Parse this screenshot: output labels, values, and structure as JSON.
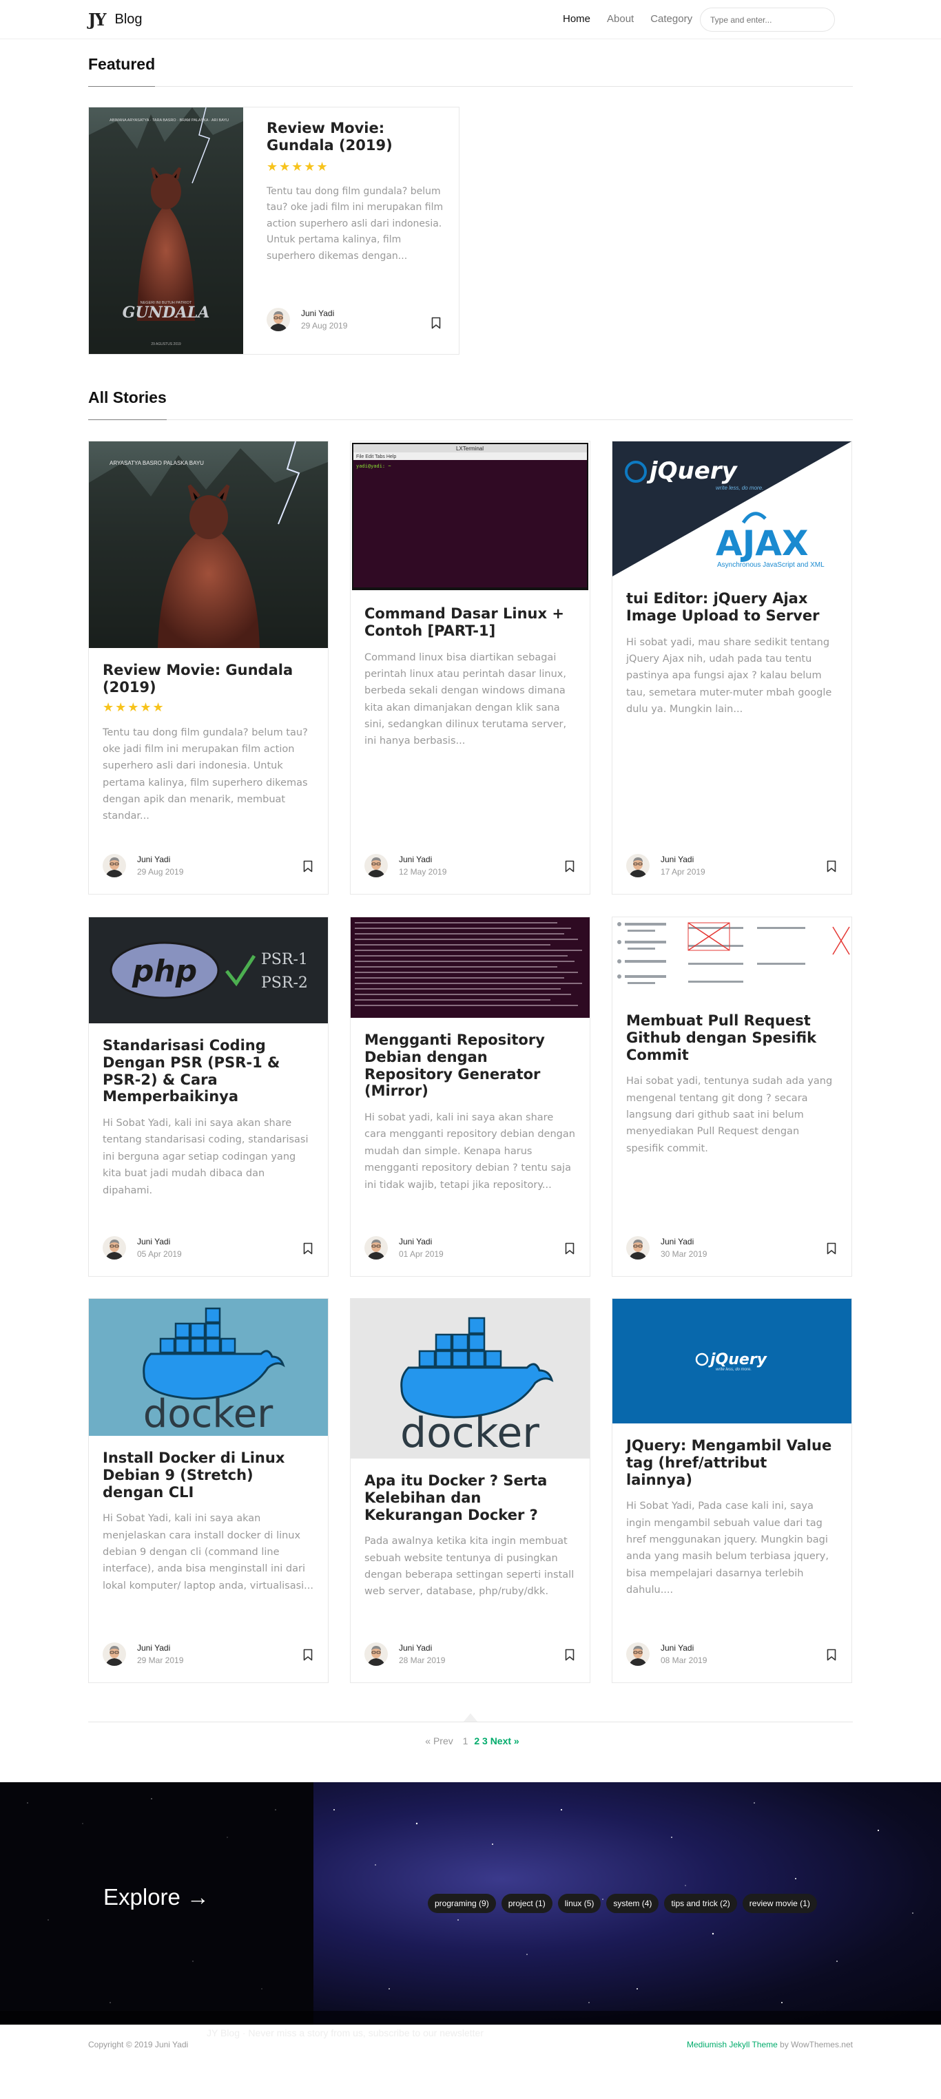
{
  "nav": {
    "logo": "JY",
    "brand": "Blog",
    "links": [
      "Home",
      "About",
      "Category"
    ],
    "search_placeholder": "Type and enter..."
  },
  "featured_section": {
    "title": "Featured",
    "post": {
      "title": "Review Movie: Gundala (2019)",
      "stars": "★★★★★",
      "excerpt": "Tentu tau dong film gundala? belum tau? oke jadi film ini merupakan film action superhero asli dari indonesia. Untuk pertama kalinya, film superhero dikemas dengan...",
      "author": "Juni Yadi",
      "date": "29 Aug 2019"
    }
  },
  "stories_section": {
    "title": "All Stories",
    "posts": [
      {
        "title": "Review Movie: Gundala (2019)",
        "stars": "★★★★★",
        "excerpt": "Tentu tau dong film gundala? belum tau? oke jadi film ini merupakan film action superhero asli dari indonesia. Untuk pertama kalinya, film superhero dikemas dengan apik dan menarik, membuat standar...",
        "author": "Juni Yadi",
        "date": "29 Aug 2019"
      },
      {
        "title": "Command Dasar Linux + Contoh [PART-1]",
        "stars": "",
        "excerpt": "Command linux bisa diartikan sebagai perintah linux atau perintah dasar linux, berbeda sekali dengan windows dimana kita akan dimanjakan dengan klik sana sini, sedangkan dilinux terutama server, ini hanya berbasis...",
        "author": "Juni Yadi",
        "date": "12 May 2019"
      },
      {
        "title": "tui Editor: jQuery Ajax Image Upload to Server",
        "stars": "",
        "excerpt": "Hi sobat yadi, mau share sedikit tentang jQuery Ajax nih, udah pada tau tentu pastinya apa fungsi ajax ? kalau belum tau, semetara muter-muter mbah google dulu ya. Mungkin lain...",
        "author": "Juni Yadi",
        "date": "17 Apr 2019"
      },
      {
        "title": "Standarisasi Coding Dengan PSR (PSR-1 & PSR-2) & Cara Memperbaikinya",
        "stars": "",
        "excerpt": "Hi Sobat Yadi, kali ini saya akan share tentang standarisasi coding, standarisasi ini berguna agar setiap codingan yang kita buat jadi mudah dibaca dan dipahami.",
        "author": "Juni Yadi",
        "date": "05 Apr 2019"
      },
      {
        "title": "Mengganti Repository Debian dengan Repository Generator (Mirror)",
        "stars": "",
        "excerpt": "Hi sobat yadi, kali ini saya akan share cara mengganti repository debian dengan mudah dan simple. Kenapa harus mengganti repository debian ? tentu saja ini tidak wajib, tetapi jika repository...",
        "author": "Juni Yadi",
        "date": "01 Apr 2019"
      },
      {
        "title": "Membuat Pull Request Github dengan Spesifik Commit",
        "stars": "",
        "excerpt": "Hai sobat yadi, tentunya sudah ada yang mengenal tentang git dong ? secara langsung dari github saat ini belum menyediakan Pull Request dengan spesifik commit.",
        "author": "Juni Yadi",
        "date": "30 Mar 2019"
      },
      {
        "title": "Install Docker di Linux Debian 9 (Stretch) dengan CLI",
        "stars": "",
        "excerpt": "Hi Sobat Yadi, kali ini saya akan menjelaskan cara install docker di linux debian 9 dengan cli (command line interface), anda bisa menginstall ini dari lokal komputer/ laptop anda, virtualisasi...",
        "author": "Juni Yadi",
        "date": "29 Mar 2019"
      },
      {
        "title": "Apa itu Docker ? Serta Kelebihan dan Kekurangan Docker ?",
        "stars": "",
        "excerpt": "Pada awalnya ketika kita ingin membuat sebuah website tentunya di pusingkan dengan beberapa settingan seperti install web server, database, php/ruby/dkk.",
        "author": "Juni Yadi",
        "date": "28 Mar 2019"
      },
      {
        "title": "JQuery: Mengambil Value tag (href/attribut lainnya)",
        "stars": "",
        "excerpt": "Hi Sobat Yadi, Pada case kali ini, saya ingin mengambil sebuah value dari tag href menggunakan jquery. Mungkin bagi anda yang masih belum terbiasa jquery, bisa mempelajari dasarnya terlebih dahulu....",
        "author": "Juni Yadi",
        "date": "08 Mar 2019"
      }
    ]
  },
  "images": {
    "gundala_caption": "GUNDALA",
    "gundala_tagline": "NEGERI INI BUTUH PATRIOT",
    "gundala_names": [
      "ABIMANA ARYASATYA",
      "TARA BASRO",
      "BRAM PALASKA",
      "RIO DEWANTO",
      "ARI BAYU"
    ],
    "gundala_release": "29 AGUSTUS 2019",
    "terminal_title": "LXTerminal",
    "terminal_menu": [
      "File",
      "Edit",
      "Tabs",
      "Help"
    ],
    "terminal_prompt": "yadi@yadi: ~",
    "jquery_logo": "jQuery",
    "jquery_tagline": "write less, do more.",
    "ajax_logo": "AJAX",
    "ajax_tagline": "Asynchronous JavaScript and XML",
    "php_logo": "php",
    "psr1": "PSR-1",
    "psr2": "PSR-2",
    "docker_logo": "docker"
  },
  "pagination": {
    "prev": "« Prev",
    "pages": [
      "1",
      "2",
      "3"
    ],
    "next": "Next »"
  },
  "explore": {
    "title": "Explore →",
    "tags": [
      "programing (9)",
      "project (1)",
      "linux (5)",
      "system (4)",
      "tips and trick (2)",
      "review movie (1)"
    ]
  },
  "footer": {
    "copyright": "Copyright © 2019 Juni Yadi",
    "alert": "JY Blog · Never miss a story from us, subscribe to our newsletter",
    "credit_theme": "Mediumish Jekyll Theme",
    "credit_by": "by WowThemes.net"
  },
  "colors": {
    "accent": "#00ab6b",
    "star": "#f7c31c",
    "text": "#222222",
    "muted": "#999999"
  }
}
